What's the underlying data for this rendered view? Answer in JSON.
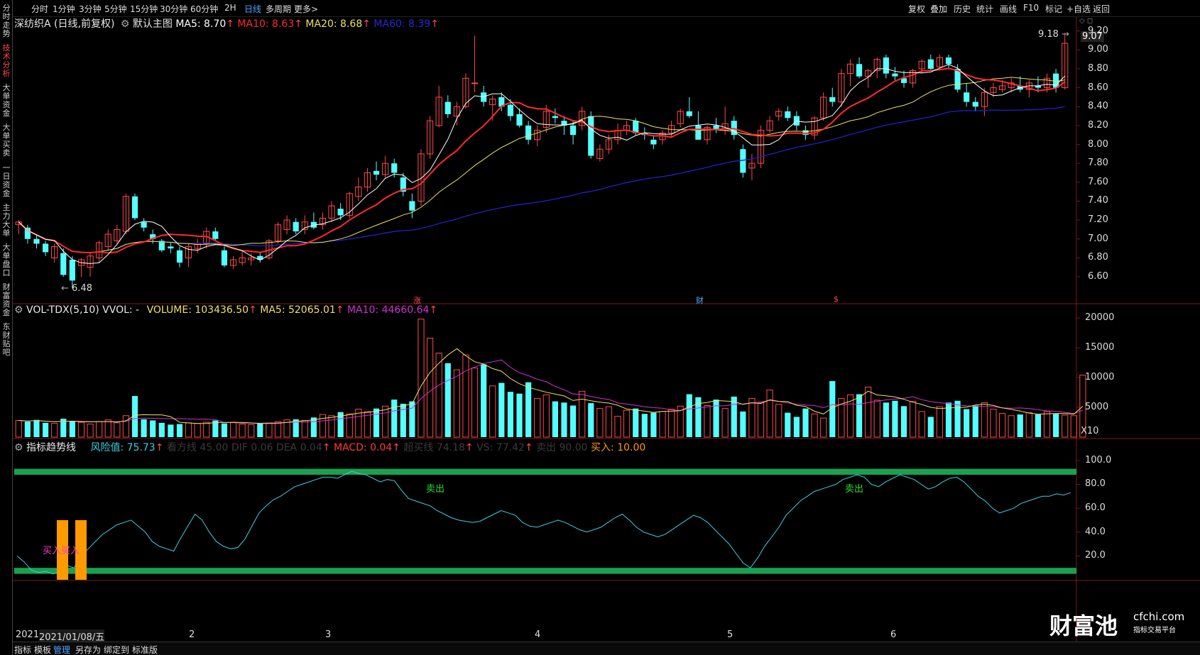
{
  "toolbar": {
    "periods": [
      "分时",
      "1分钟",
      "3分钟",
      "5分钟",
      "15分钟",
      "30分钟",
      "60分钟",
      "2H",
      "日线",
      "多周期",
      "更多>"
    ],
    "active_period": "日线",
    "right": [
      "复权",
      "叠加",
      "历史",
      "统计",
      "画线",
      "F10",
      "标记",
      "+自选",
      "返回"
    ]
  },
  "leftbar": {
    "tabs": [
      "分时走势",
      "技术分析",
      "大单资金",
      "大单买卖",
      "一日资金",
      "主力大单",
      "大单盘口",
      "财富资金",
      "东财贴吧"
    ],
    "active": "技术分析"
  },
  "price_panel": {
    "stock": "深纺织A (日线,前复权)",
    "template": "默认主图",
    "ma5": "MA5: 8.70",
    "ma10": "MA10: 8.63",
    "ma20": "MA20: 8.68",
    "ma60": "MA60: 8.39",
    "arrow": "↑",
    "high_label": "9.18",
    "low_label": "6.48",
    "last_price": "9.07",
    "markers": {
      "zhang": "涨",
      "cai": "财",
      "s": "$"
    },
    "colors": {
      "ma5": "#ffffff",
      "ma10": "#ff2a2a",
      "ma20": "#f0e060",
      "ma60": "#2020c8",
      "up": "#ff4a4a",
      "down": "#54ffff"
    }
  },
  "vol_panel": {
    "title": "VOL-TDX(5,10) VVOL: -",
    "volume": "VOLUME: 103436.50",
    "ma5": "MA5: 52065.01",
    "ma10": "MA10: 44660.64",
    "unit": "X10",
    "colors": {
      "ma5": "#f0e060",
      "ma10": "#d030d0"
    }
  },
  "ind_panel": {
    "title": "指标趋势线",
    "risk": "风险值: 75.73",
    "faded": "看方线 45.00 DIF 0.06   DEA 0.04",
    "macd": "MACD: 0.04",
    "faded2": "超买线 74.18",
    "faded3": "VS: 77.42",
    "faded4": "卖出 90.00",
    "buy": "买入: 10.00",
    "sell_label": "卖出",
    "buy_label": "买入买入",
    "colors": {
      "risk": "#3ad0e0",
      "band": "#1aa050",
      "buy": "#ff9a00",
      "sell_text": "#2fdc2f"
    }
  },
  "dates": {
    "first": "2021",
    "cursor": "2021/01/08/五",
    "months": [
      "2",
      "3",
      "4",
      "5",
      "6"
    ]
  },
  "bottombar": {
    "items": [
      "指标",
      "模板",
      "管理",
      "另存为",
      "绑定到",
      "标准版"
    ],
    "active": "管理"
  },
  "logo": {
    "name": "财富池",
    "domain": "cfchi.com",
    "sub": "指标交易平台"
  },
  "chart_data": [
    {
      "type": "candlestick",
      "title": "深纺织A (日线,前复权)",
      "ylim": [
        6.45,
        9.25
      ],
      "y_ticks": [
        9.2,
        9.0,
        8.8,
        8.6,
        8.4,
        8.2,
        8.0,
        7.8,
        7.6,
        7.4,
        7.2,
        7.0,
        6.8,
        6.6
      ],
      "ohlc": [
        [
          7.15,
          7.2,
          7.05,
          7.18
        ],
        [
          7.12,
          7.15,
          6.95,
          7.0
        ],
        [
          7.0,
          7.05,
          6.9,
          6.95
        ],
        [
          6.95,
          6.98,
          6.82,
          6.86
        ],
        [
          6.8,
          6.95,
          6.75,
          6.92
        ],
        [
          6.85,
          6.9,
          6.6,
          6.62
        ],
        [
          6.78,
          6.82,
          6.48,
          6.56
        ],
        [
          6.72,
          6.8,
          6.6,
          6.78
        ],
        [
          6.7,
          6.85,
          6.6,
          6.82
        ],
        [
          6.8,
          6.98,
          6.75,
          6.96
        ],
        [
          6.92,
          7.1,
          6.88,
          7.05
        ],
        [
          6.98,
          7.15,
          6.95,
          7.1
        ],
        [
          7.08,
          7.48,
          7.05,
          7.45
        ],
        [
          7.45,
          7.48,
          7.2,
          7.22
        ],
        [
          7.18,
          7.22,
          7.08,
          7.12
        ],
        [
          7.05,
          7.1,
          6.95,
          7.0
        ],
        [
          6.98,
          7.0,
          6.86,
          6.88
        ],
        [
          6.92,
          6.96,
          6.85,
          6.9
        ],
        [
          6.88,
          6.92,
          6.7,
          6.75
        ],
        [
          6.8,
          6.95,
          6.7,
          6.92
        ],
        [
          6.9,
          7.0,
          6.85,
          6.95
        ],
        [
          6.95,
          7.12,
          6.9,
          7.08
        ],
        [
          7.08,
          7.12,
          6.98,
          7.0
        ],
        [
          6.88,
          6.92,
          6.7,
          6.72
        ],
        [
          6.72,
          6.82,
          6.68,
          6.78
        ],
        [
          6.75,
          6.88,
          6.72,
          6.8
        ],
        [
          6.78,
          6.85,
          6.72,
          6.8
        ],
        [
          6.82,
          6.86,
          6.75,
          6.78
        ],
        [
          6.8,
          7.0,
          6.78,
          6.98
        ],
        [
          6.98,
          7.18,
          6.95,
          7.15
        ],
        [
          7.1,
          7.25,
          7.05,
          7.2
        ],
        [
          7.18,
          7.22,
          7.05,
          7.08
        ],
        [
          7.1,
          7.25,
          7.05,
          7.18
        ],
        [
          7.18,
          7.28,
          7.1,
          7.12
        ],
        [
          7.15,
          7.28,
          7.1,
          7.22
        ],
        [
          7.22,
          7.4,
          7.18,
          7.35
        ],
        [
          7.32,
          7.38,
          7.2,
          7.25
        ],
        [
          7.25,
          7.5,
          7.22,
          7.48
        ],
        [
          7.45,
          7.65,
          7.4,
          7.55
        ],
        [
          7.55,
          7.75,
          7.5,
          7.7
        ],
        [
          7.72,
          7.82,
          7.62,
          7.68
        ],
        [
          7.68,
          7.88,
          7.65,
          7.8
        ],
        [
          7.8,
          7.85,
          7.65,
          7.7
        ],
        [
          7.65,
          7.7,
          7.45,
          7.5
        ],
        [
          7.4,
          7.48,
          7.22,
          7.3
        ],
        [
          7.4,
          7.95,
          7.35,
          7.9
        ],
        [
          7.9,
          8.3,
          7.85,
          8.25
        ],
        [
          8.2,
          8.62,
          8.18,
          8.5
        ],
        [
          8.45,
          8.52,
          8.28,
          8.32
        ],
        [
          8.3,
          8.45,
          8.2,
          8.4
        ],
        [
          8.4,
          8.75,
          8.38,
          8.7
        ],
        [
          8.65,
          9.15,
          8.55,
          8.65
        ],
        [
          8.55,
          8.62,
          8.4,
          8.45
        ],
        [
          8.42,
          8.52,
          8.25,
          8.48
        ],
        [
          8.5,
          8.55,
          8.35,
          8.4
        ],
        [
          8.42,
          8.48,
          8.25,
          8.3
        ],
        [
          8.32,
          8.38,
          8.18,
          8.2
        ],
        [
          8.2,
          8.25,
          8.0,
          8.05
        ],
        [
          8.05,
          8.2,
          7.98,
          8.15
        ],
        [
          8.18,
          8.42,
          8.12,
          8.35
        ],
        [
          8.3,
          8.38,
          8.22,
          8.28
        ],
        [
          8.25,
          8.3,
          8.1,
          8.2
        ],
        [
          8.2,
          8.25,
          8.0,
          8.1
        ],
        [
          8.2,
          8.4,
          8.15,
          8.35
        ],
        [
          8.3,
          8.35,
          7.85,
          7.88
        ],
        [
          7.85,
          8.0,
          7.82,
          7.95
        ],
        [
          7.95,
          8.1,
          7.9,
          8.05
        ],
        [
          8.05,
          8.22,
          8.0,
          8.15
        ],
        [
          8.15,
          8.25,
          8.1,
          8.2
        ],
        [
          8.25,
          8.28,
          8.1,
          8.12
        ],
        [
          8.12,
          8.18,
          8.05,
          8.1
        ],
        [
          8.05,
          8.1,
          7.95,
          8.0
        ],
        [
          8.05,
          8.15,
          8.0,
          8.12
        ],
        [
          8.12,
          8.25,
          8.08,
          8.2
        ],
        [
          8.22,
          8.38,
          8.18,
          8.35
        ],
        [
          8.35,
          8.5,
          8.28,
          8.3
        ],
        [
          8.2,
          8.35,
          8.1,
          8.05
        ],
        [
          8.05,
          8.2,
          8.0,
          8.18
        ],
        [
          8.2,
          8.28,
          8.12,
          8.15
        ],
        [
          8.15,
          8.4,
          8.1,
          8.22
        ],
        [
          8.25,
          8.3,
          8.05,
          8.1
        ],
        [
          7.95,
          8.0,
          7.65,
          7.7
        ],
        [
          7.75,
          7.9,
          7.62,
          7.8
        ],
        [
          7.8,
          8.2,
          7.75,
          8.15
        ],
        [
          8.15,
          8.3,
          8.12,
          8.25
        ],
        [
          8.3,
          8.38,
          8.25,
          8.35
        ],
        [
          8.35,
          8.4,
          8.25,
          8.28
        ],
        [
          8.3,
          8.35,
          8.15,
          8.2
        ],
        [
          8.15,
          8.2,
          8.05,
          8.1
        ],
        [
          8.1,
          8.3,
          8.05,
          8.28
        ],
        [
          8.28,
          8.55,
          8.25,
          8.5
        ],
        [
          8.5,
          8.6,
          8.4,
          8.45
        ],
        [
          8.45,
          8.8,
          8.4,
          8.75
        ],
        [
          8.75,
          8.9,
          8.62,
          8.85
        ],
        [
          8.85,
          8.92,
          8.7,
          8.72
        ],
        [
          8.72,
          8.8,
          8.6,
          8.78
        ],
        [
          8.78,
          8.92,
          8.7,
          8.9
        ],
        [
          8.92,
          8.95,
          8.7,
          8.75
        ],
        [
          8.75,
          8.82,
          8.68,
          8.72
        ],
        [
          8.7,
          8.78,
          8.6,
          8.65
        ],
        [
          8.65,
          8.8,
          8.6,
          8.78
        ],
        [
          8.8,
          8.9,
          8.75,
          8.88
        ],
        [
          8.9,
          8.95,
          8.78,
          8.8
        ],
        [
          8.82,
          8.95,
          8.8,
          8.92
        ],
        [
          8.92,
          8.95,
          8.8,
          8.85
        ],
        [
          8.8,
          8.85,
          8.55,
          8.58
        ],
        [
          8.55,
          8.65,
          8.4,
          8.45
        ],
        [
          8.45,
          8.5,
          8.35,
          8.4
        ],
        [
          8.4,
          8.6,
          8.3,
          8.55
        ],
        [
          8.55,
          8.65,
          8.5,
          8.6
        ],
        [
          8.58,
          8.68,
          8.55,
          8.62
        ],
        [
          8.6,
          8.7,
          8.55,
          8.65
        ],
        [
          8.62,
          8.72,
          8.55,
          8.58
        ],
        [
          8.58,
          8.68,
          8.5,
          8.65
        ],
        [
          8.62,
          8.72,
          8.55,
          8.6
        ],
        [
          8.6,
          8.75,
          8.55,
          8.7
        ],
        [
          8.75,
          8.8,
          8.55,
          8.6
        ],
        [
          8.6,
          9.18,
          8.58,
          9.07
        ]
      ]
    },
    {
      "type": "bar",
      "title": "VOL-TDX(5,10)",
      "ylim": [
        0,
        20000
      ],
      "y_ticks": [
        20000,
        15000,
        10000,
        5000
      ],
      "values": [
        2800,
        2600,
        2900,
        2400,
        2300,
        3100,
        2700,
        2500,
        2200,
        2600,
        2900,
        2400,
        3600,
        6900,
        3000,
        2800,
        2400,
        2100,
        2200,
        2400,
        2300,
        2500,
        2800,
        2300,
        2500,
        2200,
        2100,
        2300,
        2400,
        2600,
        2900,
        3000,
        2800,
        3300,
        3800,
        3600,
        4200,
        3900,
        4700,
        4300,
        4800,
        5200,
        6300,
        5600,
        6000,
        19800,
        16600,
        14100,
        12400,
        11300,
        13800,
        11600,
        12200,
        8600,
        9100,
        7600,
        7300,
        9200,
        6500,
        7100,
        6000,
        5800,
        5300,
        7700,
        5700,
        4800,
        5100,
        3500,
        4500,
        4800,
        3900,
        4100,
        4300,
        4700,
        5200,
        7200,
        6700,
        5300,
        6300,
        4800,
        6800,
        4300,
        6500,
        5800,
        7900,
        5500,
        4100,
        3400,
        4800,
        3900,
        3200,
        9400,
        6500,
        7100,
        7200,
        8400,
        6200,
        5800,
        6100,
        5200,
        6000,
        4300,
        3400,
        5100,
        5800,
        6100,
        4700,
        5300,
        5800,
        4700,
        4000,
        3600,
        3800,
        4100,
        3800,
        4300,
        3900,
        3700,
        3600,
        10400
      ]
    },
    {
      "type": "line",
      "title": "指标趋势线",
      "ylim": [
        0,
        110
      ],
      "y_ticks": [
        100.0,
        80.0,
        60.0,
        40.0,
        20.0
      ],
      "series": [
        {
          "name": "风险值",
          "values": [
            20,
            15,
            8,
            6,
            7,
            5,
            6,
            12,
            10,
            20,
            26,
            32,
            38,
            42,
            46,
            48,
            50,
            45,
            40,
            32,
            28,
            26,
            24,
            35,
            45,
            55,
            50,
            40,
            32,
            28,
            26,
            27,
            34,
            45,
            56,
            62,
            67,
            70,
            74,
            78,
            80,
            82,
            84,
            86,
            86,
            85,
            88,
            91,
            89,
            88,
            85,
            82,
            84,
            83,
            75,
            68,
            66,
            64,
            62,
            58,
            55,
            52,
            50,
            49,
            48,
            49,
            52,
            55,
            58,
            56,
            54,
            48,
            45,
            44,
            46,
            48,
            50,
            48,
            45,
            42,
            40,
            42,
            44,
            48,
            52,
            55,
            50,
            44,
            40,
            38,
            36,
            38,
            42,
            46,
            50,
            54,
            52,
            48,
            42,
            36,
            30,
            22,
            14,
            10,
            18,
            28,
            36,
            44,
            54,
            60,
            66,
            70,
            74,
            76,
            78,
            80,
            84,
            86,
            88,
            86,
            80,
            78,
            82,
            85,
            88,
            86,
            84,
            80,
            76,
            78,
            82,
            85,
            86,
            82,
            76,
            70,
            66,
            60,
            56,
            58,
            60,
            64,
            66,
            68,
            70,
            70,
            72,
            71,
            73
          ]
        }
      ]
    }
  ]
}
